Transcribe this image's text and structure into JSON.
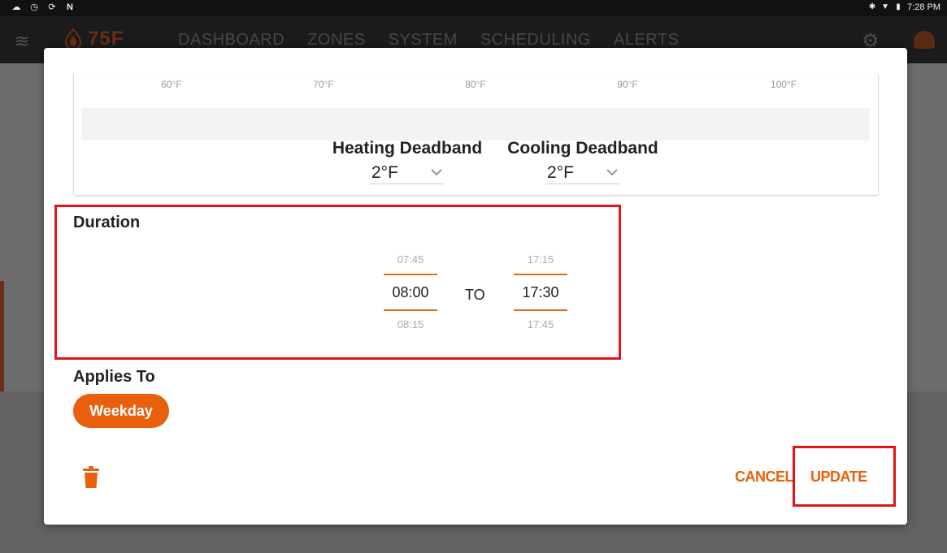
{
  "status_bar": {
    "left_icons": [
      "cloud-icon",
      "clock-icon",
      "sync-icon",
      "n-icon"
    ],
    "right_icons": [
      "bluetooth-icon",
      "wifi-icon",
      "battery-icon"
    ],
    "time": "7:28 PM"
  },
  "app_header": {
    "logo_text": "75F",
    "nav": [
      "DASHBOARD",
      "ZONES",
      "SYSTEM",
      "SCHEDULING",
      "ALERTS"
    ]
  },
  "modal": {
    "temperature_ticks": [
      "60°F",
      "70°F",
      "80°F",
      "90°F",
      "100°F"
    ],
    "heating_deadband": {
      "label": "Heating Deadband",
      "value": "2°F"
    },
    "cooling_deadband": {
      "label": "Cooling Deadband",
      "value": "2°F"
    },
    "duration": {
      "title": "Duration",
      "start": {
        "prev": "07:45",
        "current": "08:00",
        "next": "08:15"
      },
      "separator": "TO",
      "end": {
        "prev": "17:15",
        "current": "17:30",
        "next": "17:45"
      }
    },
    "applies_to": {
      "title": "Applies To",
      "chip": "Weekday"
    },
    "actions": {
      "cancel": "CANCEL",
      "update": "UPDATE"
    }
  },
  "colors": {
    "accent": "#e8600c",
    "highlight": "#e3121b"
  }
}
